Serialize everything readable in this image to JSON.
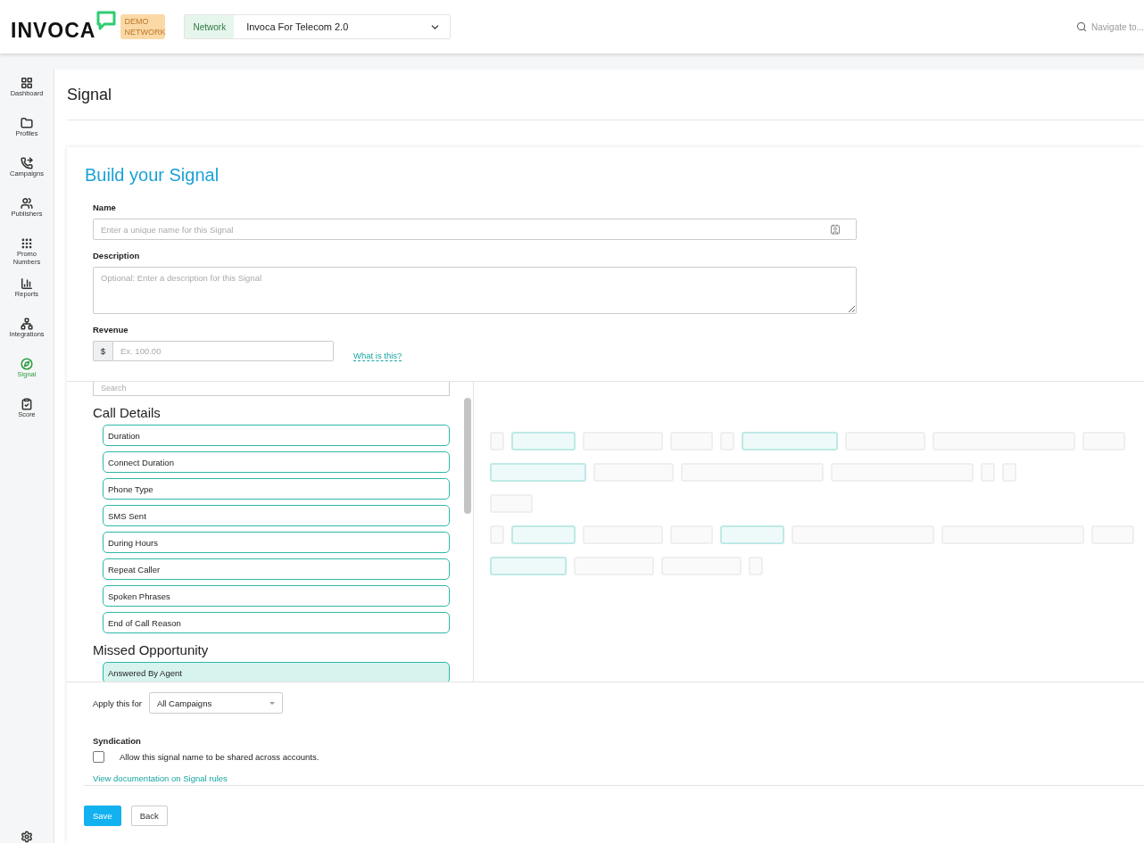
{
  "header": {
    "logo": "INVOCA",
    "badge": "DEMO NETWORK",
    "network_label": "Network",
    "network_value": "Invoca For Telecom 2.0",
    "search_placeholder": "Navigate to..."
  },
  "sidebar": {
    "items": [
      {
        "label": "Dashboard",
        "selected": false
      },
      {
        "label": "Profiles",
        "selected": false
      },
      {
        "label": "Campaigns",
        "selected": false
      },
      {
        "label": "Publishers",
        "selected": false
      },
      {
        "label": "Promo Numbers",
        "selected": false
      },
      {
        "label": "Reports",
        "selected": false
      },
      {
        "label": "Integrations",
        "selected": false
      },
      {
        "label": "Signal",
        "selected": true
      },
      {
        "label": "Score",
        "selected": false
      }
    ]
  },
  "page_title": "Signal",
  "form": {
    "heading": "Build your Signal",
    "name": {
      "label": "Name",
      "placeholder": "Enter a unique name for this Signal"
    },
    "description": {
      "label": "Description",
      "placeholder": "Optional: Enter a description for this Signal"
    },
    "revenue": {
      "label": "Revenue",
      "prefix": "$",
      "placeholder": "Ex. 100.00",
      "help_link": "What is this?"
    },
    "builder": {
      "search_placeholder": "Search",
      "groups": [
        {
          "title": "Call Details",
          "fields": [
            {
              "label": "Duration",
              "selected": false
            },
            {
              "label": "Connect Duration",
              "selected": false
            },
            {
              "label": "Phone Type",
              "selected": false
            },
            {
              "label": "SMS Sent",
              "selected": false
            },
            {
              "label": "During Hours",
              "selected": false
            },
            {
              "label": "Repeat Caller",
              "selected": false
            },
            {
              "label": "Spoken Phrases",
              "selected": false
            },
            {
              "label": "End of Call Reason",
              "selected": false
            }
          ]
        },
        {
          "title": "Missed Opportunity",
          "fields": [
            {
              "label": "Answered By Agent",
              "selected": true
            }
          ]
        }
      ]
    },
    "apply": {
      "label": "Apply this for",
      "value": "All Campaigns"
    },
    "syndication": {
      "label": "Syndication",
      "checkbox_label": "Allow this signal name to be shared across accounts.",
      "checked": false
    },
    "doc_link": "View documentation on Signal rules",
    "buttons": {
      "save": "Save",
      "back": "Back"
    }
  }
}
